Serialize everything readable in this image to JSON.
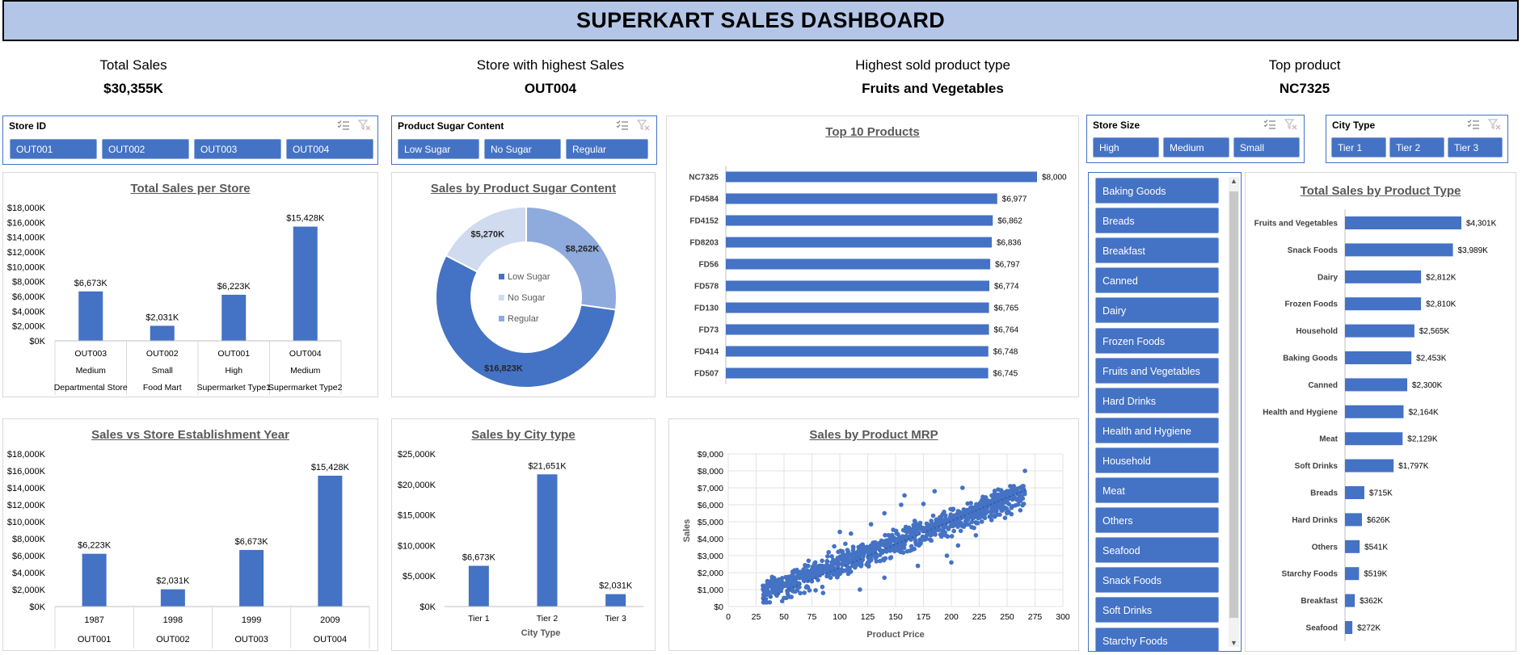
{
  "header": {
    "title": "SUPERKART SALES DASHBOARD"
  },
  "kpis": [
    {
      "label": "Total Sales",
      "value": "$30,355K"
    },
    {
      "label": "Store with highest Sales",
      "value": "OUT004"
    },
    {
      "label": "Highest sold product type",
      "value": "Fruits and Vegetables"
    },
    {
      "label": "Top product",
      "value": "NC7325"
    }
  ],
  "slicers": {
    "store_id": {
      "title": "Store ID",
      "items": [
        "OUT001",
        "OUT002",
        "OUT003",
        "OUT004"
      ]
    },
    "sugar": {
      "title": "Product Sugar Content",
      "items": [
        "Low Sugar",
        "No Sugar",
        "Regular"
      ]
    },
    "store_size": {
      "title": "Store Size",
      "items": [
        "High",
        "Medium",
        "Small"
      ]
    },
    "city_type": {
      "title": "City Type",
      "items": [
        "Tier 1",
        "Tier 2",
        "Tier 3"
      ]
    },
    "product_type": {
      "items": [
        "Baking Goods",
        "Breads",
        "Breakfast",
        "Canned",
        "Dairy",
        "Frozen Foods",
        "Fruits and Vegetables",
        "Hard Drinks",
        "Health and Hygiene",
        "Household",
        "Meat",
        "Others",
        "Seafood",
        "Snack Foods",
        "Soft Drinks",
        "Starchy Foods"
      ]
    }
  },
  "icons": {
    "multi_select": "multi-select-icon",
    "clear_filter": "clear-filter-icon",
    "scroll_up": "chevron-up-icon",
    "scroll_down": "chevron-down-icon"
  },
  "colors": {
    "accent": "#4472c4",
    "title_bg": "#b4c6e7",
    "light1": "#8faadc",
    "light2": "#d0dbf0"
  },
  "chart_data": [
    {
      "id": "store_sales",
      "type": "bar",
      "title": "Total Sales per Store",
      "categories": [
        {
          "store": "OUT003",
          "size": "Medium",
          "type": "Departmental Store"
        },
        {
          "store": "OUT002",
          "size": "Small",
          "type": "Food Mart"
        },
        {
          "store": "OUT001",
          "size": "High",
          "type": "Supermarket Type1"
        },
        {
          "store": "OUT004",
          "size": "Medium",
          "type": "Supermarket Type2"
        }
      ],
      "values": [
        6673,
        2031,
        6223,
        15428
      ],
      "data_labels": [
        "$6,673K",
        "$2,031K",
        "$6,223K",
        "$15,428K"
      ],
      "ylim": [
        0,
        18000
      ],
      "yticks": [
        "$0K",
        "$2,000K",
        "$4,000K",
        "$6,000K",
        "$8,000K",
        "$10,000K",
        "$12,000K",
        "$14,000K",
        "$16,000K",
        "$18,000K"
      ]
    },
    {
      "id": "sugar_donut",
      "type": "pie",
      "title": "Sales by Product Sugar Content",
      "series": [
        {
          "name": "Low Sugar",
          "value": 16823,
          "label": "$16,823K",
          "color": "#4472c4"
        },
        {
          "name": "No Sugar",
          "value": 5270,
          "label": "$5,270K",
          "color": "#d0dbf0"
        },
        {
          "name": "Regular",
          "value": 8262,
          "label": "$8,262K",
          "color": "#8faadc"
        }
      ]
    },
    {
      "id": "top10",
      "type": "bar",
      "title": "Top 10 Products",
      "categories": [
        "NC7325",
        "FD4584",
        "FD4152",
        "FD8203",
        "FD56",
        "FD578",
        "FD130",
        "FD73",
        "FD414",
        "FD507"
      ],
      "values": [
        8000,
        6977,
        6862,
        6836,
        6797,
        6774,
        6765,
        6764,
        6748,
        6745
      ],
      "data_labels": [
        "$8,000",
        "$6,977",
        "$6,862",
        "$6,836",
        "$6,797",
        "$6,774",
        "$6,765",
        "$6,764",
        "$6,748",
        "$6,745"
      ]
    },
    {
      "id": "product_type",
      "type": "bar",
      "title": "Total Sales by Product Type",
      "categories": [
        "Fruits and Vegetables",
        "Snack Foods",
        "Dairy",
        "Frozen Foods",
        "Household",
        "Baking Goods",
        "Canned",
        "Health and Hygiene",
        "Meat",
        "Soft Drinks",
        "Breads",
        "Hard Drinks",
        "Others",
        "Starchy Foods",
        "Breakfast",
        "Seafood"
      ],
      "values": [
        4301,
        3989,
        2812,
        2810,
        2565,
        2453,
        2300,
        2164,
        2129,
        1797,
        715,
        626,
        541,
        519,
        362,
        272
      ],
      "data_labels": [
        "$4,301K",
        "$3,989K",
        "$2,812K",
        "$2,810K",
        "$2,565K",
        "$2,453K",
        "$2,300K",
        "$2,164K",
        "$2,129K",
        "$1,797K",
        "$715K",
        "$626K",
        "$541K",
        "$519K",
        "$362K",
        "$272K"
      ]
    },
    {
      "id": "establishment",
      "type": "bar",
      "title": "Sales vs Store Establishment Year",
      "categories": [
        {
          "year": "1987",
          "store": "OUT001"
        },
        {
          "year": "1998",
          "store": "OUT002"
        },
        {
          "year": "1999",
          "store": "OUT003"
        },
        {
          "year": "2009",
          "store": "OUT004"
        }
      ],
      "values": [
        6223,
        2031,
        6673,
        15428
      ],
      "data_labels": [
        "$6,223K",
        "$2,031K",
        "$6,673K",
        "$15,428K"
      ],
      "ylim": [
        0,
        18000
      ],
      "yticks": [
        "$0K",
        "$2,000K",
        "$4,000K",
        "$6,000K",
        "$8,000K",
        "$10,000K",
        "$12,000K",
        "$14,000K",
        "$16,000K",
        "$18,000K"
      ]
    },
    {
      "id": "city_type",
      "type": "bar",
      "title": "Sales by City type",
      "xlabel": "City Type",
      "categories": [
        "Tier 1",
        "Tier 2",
        "Tier 3"
      ],
      "values": [
        6673,
        21651,
        2031
      ],
      "data_labels": [
        "$6,673K",
        "$21,651K",
        "$2,031K"
      ],
      "ylim": [
        0,
        25000
      ],
      "yticks": [
        "$0K",
        "$5,000K",
        "$10,000K",
        "$15,000K",
        "$20,000K",
        "$25,000K"
      ]
    },
    {
      "id": "mrp_scatter",
      "type": "scatter",
      "title": "Sales by Product MRP",
      "xlabel": "Product Price",
      "ylabel": "Sales",
      "xlim": [
        0,
        300
      ],
      "ylim": [
        0,
        9000
      ],
      "xticks": [
        "0",
        "25",
        "50",
        "75",
        "100",
        "125",
        "150",
        "175",
        "200",
        "225",
        "250",
        "275",
        "300"
      ],
      "yticks": [
        "$0",
        "$1,000",
        "$2,000",
        "$3,000",
        "$4,000",
        "$5,000",
        "$6,000",
        "$7,000",
        "$8,000",
        "$9,000"
      ],
      "trend": {
        "x0": 31,
        "y0": 380,
        "x1": 266,
        "y1": 6870
      },
      "cluster": {
        "price_min": 31,
        "price_max": 266,
        "sales_per_price": 25.5,
        "spread_low": 1200,
        "spread_high": 900
      },
      "outliers": [
        [
          266,
          8000
        ],
        [
          72,
          2700
        ],
        [
          70,
          2050
        ],
        [
          90,
          3200
        ],
        [
          105,
          3700
        ],
        [
          110,
          4300
        ],
        [
          128,
          4850
        ],
        [
          140,
          5500
        ],
        [
          155,
          6000
        ],
        [
          158,
          6550
        ],
        [
          182,
          5050
        ],
        [
          196,
          3000
        ],
        [
          206,
          3600
        ],
        [
          222,
          4200
        ],
        [
          236,
          5100
        ],
        [
          242,
          6900
        ],
        [
          248,
          6600
        ],
        [
          210,
          7000
        ],
        [
          250,
          5500
        ],
        [
          140,
          1700
        ],
        [
          118,
          1000
        ],
        [
          100,
          4400
        ],
        [
          175,
          6050
        ],
        [
          185,
          6800
        ],
        [
          170,
          2400
        ],
        [
          200,
          2600
        ],
        [
          85,
          800
        ],
        [
          60,
          1400
        ],
        [
          78,
          2600
        ],
        [
          95,
          3550
        ]
      ]
    }
  ]
}
